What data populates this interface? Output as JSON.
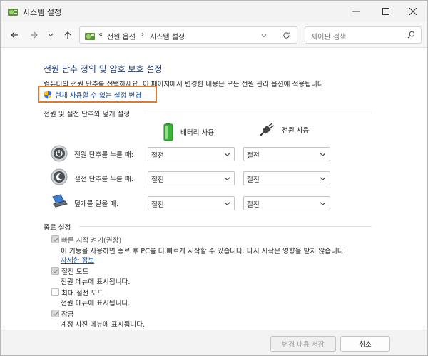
{
  "window": {
    "title": "시스템 설정"
  },
  "nav": {
    "breadcrumb_prefix": "«",
    "crumb1": "전원 옵션",
    "separator": "›",
    "crumb2": "시스템 설정",
    "search_placeholder": "제어판 검색"
  },
  "page": {
    "heading": "전원 단추 정의 및 암호 보호 설정",
    "description": "컴퓨터의 전원 단추를 선택하세요. 이 페이지에서 변경한 내용은 모든 전원 관리 옵션에 적용됩니다.",
    "change_settings_link": "현재 사용할 수 없는 설정 변경"
  },
  "buttons_section": {
    "title": "전원 및 절전 단추와 덮개 설정",
    "col_battery": "배터리 사용",
    "col_plugged": "전원 사용",
    "rows": [
      {
        "label": "전원 단추를 누를 때:",
        "battery": "절전",
        "plugged": "절전",
        "icon": "power-button-icon"
      },
      {
        "label": "절전 단추를 누를 때:",
        "battery": "절전",
        "plugged": "절전",
        "icon": "sleep-button-icon"
      },
      {
        "label": "덮개를 닫을 때:",
        "battery": "절전",
        "plugged": "절전",
        "icon": "laptop-lid-icon"
      }
    ]
  },
  "shutdown_section": {
    "title": "종료 설정",
    "items": [
      {
        "label": "빠른 시작 켜기(권장)",
        "checked": true,
        "desc": "이 기능을 사용하면 종료 후 PC를 더 빠르게 시작할 수 있습니다. 다시 시작은 영향을 받지 않습니다.",
        "link": "자세한 정보"
      },
      {
        "label": "절전 모드",
        "checked": true,
        "desc": "전원 메뉴에 표시됩니다."
      },
      {
        "label": "최대 절전 모드",
        "checked": false,
        "desc": "전원 메뉴에 표시됩니다."
      },
      {
        "label": "잠금",
        "checked": true,
        "desc": "계정 사진 메뉴에 표시됩니다."
      }
    ]
  },
  "footer": {
    "save": "변경 내용 저장",
    "cancel": "취소"
  },
  "colors": {
    "heading": "#1e3a6e",
    "link": "#0a4a9e",
    "highlight_border": "#e07a2e",
    "battery_green": "#3bb33b"
  }
}
